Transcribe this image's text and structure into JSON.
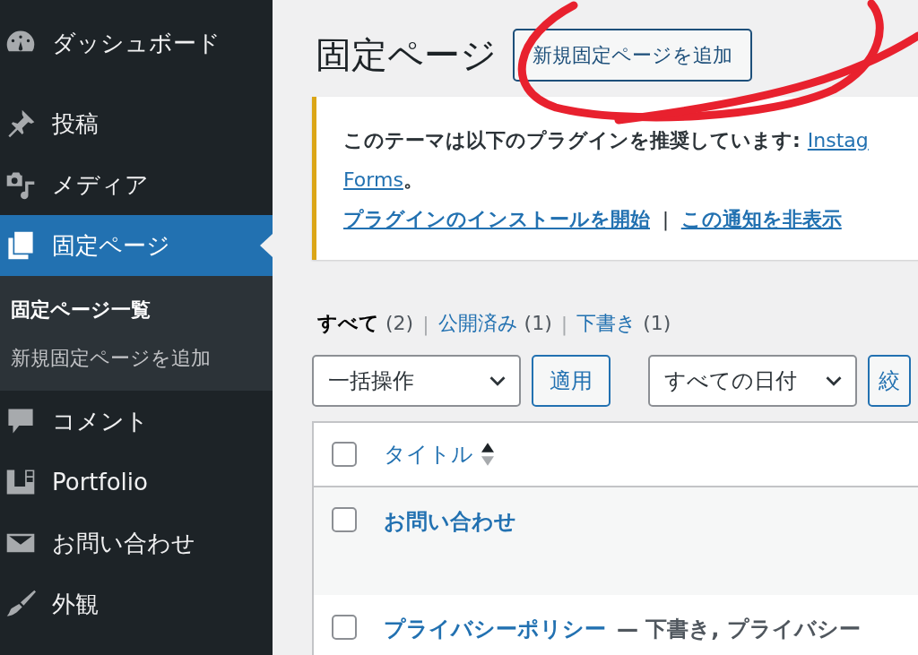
{
  "sidebar": {
    "items": [
      {
        "label": "ダッシュボード",
        "selected": false
      },
      {
        "label": "投稿",
        "selected": false
      },
      {
        "label": "メディア",
        "selected": false
      },
      {
        "label": "固定ページ",
        "selected": true,
        "children": [
          {
            "label": "固定ページ一覧",
            "selected": true
          },
          {
            "label": "新規固定ページを追加",
            "selected": false
          }
        ]
      },
      {
        "label": "コメント",
        "selected": false
      },
      {
        "label": "Portfolio",
        "selected": false
      },
      {
        "label": "お問い合わせ",
        "selected": false
      },
      {
        "label": "外観",
        "selected": false
      }
    ]
  },
  "page": {
    "title": "固定ページ",
    "add_button": "新規固定ページを追加"
  },
  "notice": {
    "text": "このテーマは以下のプラグインを推奨しています:",
    "links": [
      "Instag",
      "Forms"
    ],
    "end": "。",
    "actions": [
      "プラグインのインストールを開始",
      "この通知を非表示"
    ],
    "separator": "|"
  },
  "filters": [
    {
      "label": "すべて",
      "count": "(2)",
      "selected": true
    },
    {
      "label": "公開済み",
      "count": "(1)",
      "selected": false
    },
    {
      "label": "下書き",
      "count": "(1)",
      "selected": false
    }
  ],
  "filter_separator": "|",
  "toolbar": {
    "bulk_action": "一括操作",
    "apply": "適用",
    "date_filter": "すべての日付",
    "filter_button": "絞"
  },
  "table": {
    "header": {
      "title": "タイトル",
      "checked": false
    },
    "rows": [
      {
        "title": "お問い合わせ",
        "checked": false
      },
      {
        "title": "プライバシーポリシー",
        "state": "— 下書き, プライバシー",
        "checked": false
      }
    ]
  }
}
